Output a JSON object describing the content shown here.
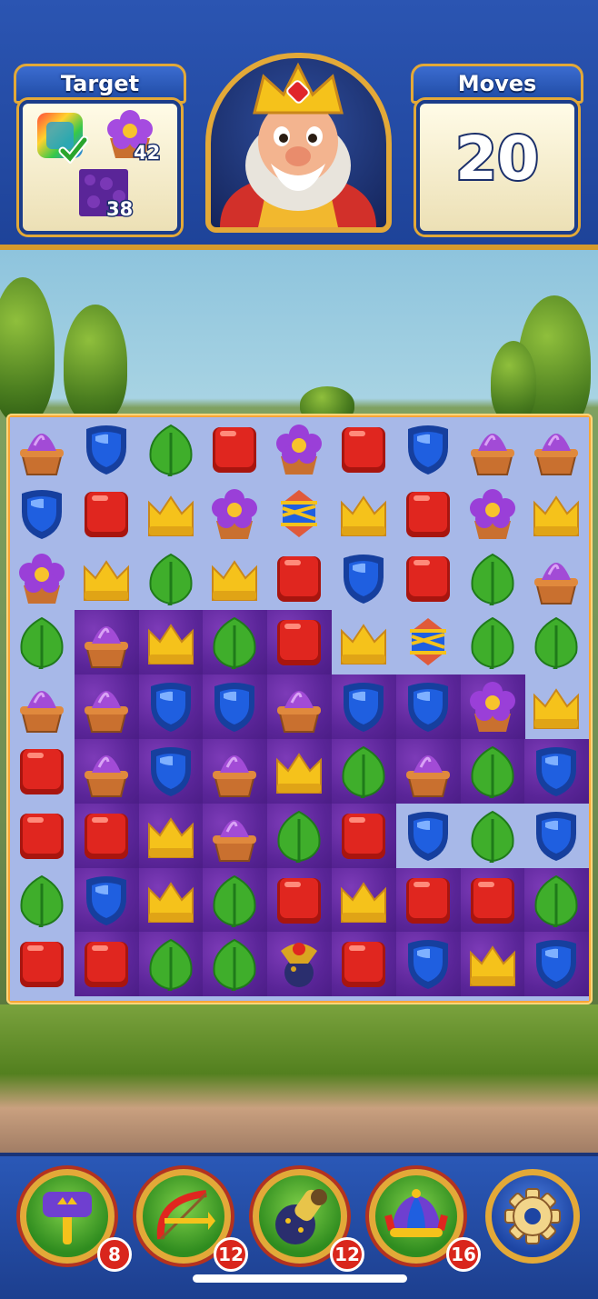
{
  "header": {
    "target_label": "Target",
    "moves_label": "Moves",
    "moves_value": "20",
    "targets": [
      {
        "icon": "rainbow-tile-completed-icon",
        "count": ""
      },
      {
        "icon": "purple-flower-icon",
        "count": "42"
      },
      {
        "icon": "purple-carpet-icon",
        "count": "38"
      }
    ],
    "character": "king-portrait"
  },
  "board": {
    "rows": 9,
    "cols": 9,
    "tiles": [
      [
        "pot",
        "shield",
        "leaf",
        "box",
        "flower",
        "box",
        "shield",
        "pot",
        "pot"
      ],
      [
        "shield",
        "box",
        "crown",
        "flower",
        "rocket",
        "crown",
        "box",
        "flower",
        "crown"
      ],
      [
        "flower",
        "crown",
        "leaf",
        "crown",
        "box",
        "shield",
        "box",
        "leaf",
        "pot"
      ],
      [
        "leaf",
        "pot",
        "crown",
        "leaf",
        "box",
        "crown",
        "rocket",
        "leaf",
        "leaf"
      ],
      [
        "pot",
        "pot",
        "shield",
        "shield",
        "pot",
        "shield",
        "shield",
        "flower",
        "crown"
      ],
      [
        "box",
        "pot",
        "shield",
        "pot",
        "crown",
        "leaf",
        "pot",
        "leaf",
        "shield"
      ],
      [
        "box",
        "box",
        "crown",
        "pot",
        "leaf",
        "box",
        "shield",
        "leaf",
        "shield"
      ],
      [
        "leaf",
        "shield",
        "crown",
        "leaf",
        "box",
        "crown",
        "box",
        "box",
        "leaf"
      ],
      [
        "box",
        "box",
        "leaf",
        "leaf",
        "cannon",
        "box",
        "shield",
        "crown",
        "shield"
      ]
    ],
    "carpet": [
      [
        0,
        0,
        0,
        0,
        0,
        0,
        0,
        0,
        0
      ],
      [
        0,
        0,
        0,
        0,
        0,
        0,
        0,
        0,
        0
      ],
      [
        0,
        0,
        0,
        0,
        0,
        0,
        0,
        0,
        0
      ],
      [
        0,
        1,
        1,
        1,
        1,
        0,
        0,
        0,
        0
      ],
      [
        0,
        1,
        1,
        1,
        1,
        1,
        1,
        1,
        0
      ],
      [
        0,
        1,
        1,
        1,
        1,
        1,
        1,
        1,
        1
      ],
      [
        0,
        1,
        1,
        1,
        1,
        1,
        0,
        0,
        0
      ],
      [
        0,
        1,
        1,
        1,
        1,
        1,
        1,
        1,
        1
      ],
      [
        0,
        1,
        1,
        1,
        1,
        1,
        1,
        1,
        1
      ]
    ],
    "colors": {
      "pot": "#a24bd6",
      "shield": "#1f5fe0",
      "leaf": "#3fae2b",
      "box": "#e0261f",
      "crown": "#f5c21b",
      "flower": "#9a3fd8",
      "rocket": "#e05a3a",
      "cannon": "#d9a521"
    }
  },
  "boosters": [
    {
      "name": "hammer",
      "icon": "hammer-icon",
      "count": "8"
    },
    {
      "name": "arrow",
      "icon": "crossbow-icon",
      "count": "12"
    },
    {
      "name": "cannon",
      "icon": "cannon-icon",
      "count": "12"
    },
    {
      "name": "jester",
      "icon": "jester-hat-icon",
      "count": "16"
    }
  ],
  "settings_icon": "gear-icon"
}
